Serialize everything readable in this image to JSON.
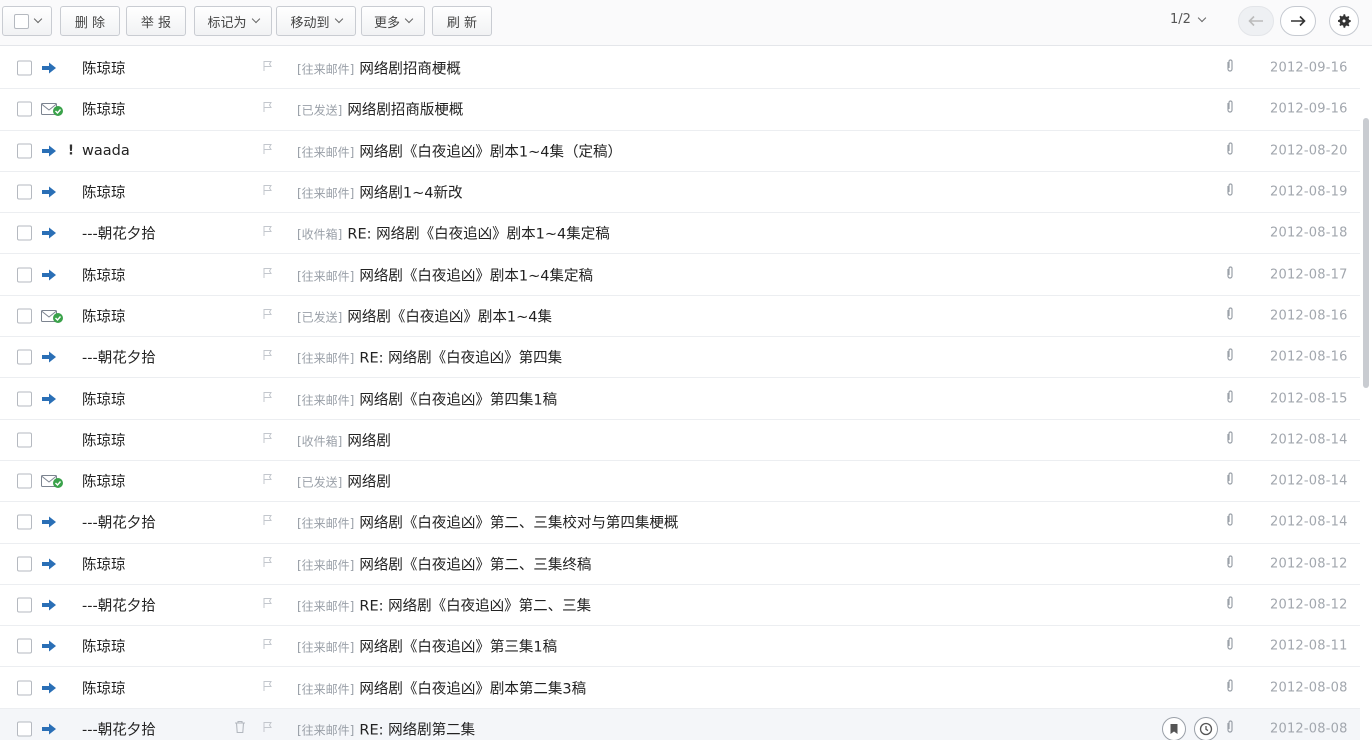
{
  "toolbar": {
    "delete_label": "删 除",
    "report_label": "举 报",
    "mark_as_label": "标记为",
    "move_to_label": "移动到",
    "more_label": "更多",
    "refresh_label": "刷 新",
    "page_indicator": "1/2"
  },
  "colors": {
    "arrow_blue": "#2a6fb6",
    "sent_green": "#3aa24a",
    "folder_gray": "#9aa0a8",
    "date_gray": "#a2a7ae"
  },
  "emails": [
    {
      "sender": "陈琼琼",
      "icon": "forward-arrow-icon",
      "important": "",
      "folder": "[往来邮件]",
      "subject": "网络剧招商梗概",
      "attachment": true,
      "date": "2012-09-16"
    },
    {
      "sender": "陈琼琼",
      "icon": "sent-envelope-icon",
      "important": "",
      "folder": "[已发送]",
      "subject": "网络剧招商版梗概",
      "attachment": true,
      "date": "2012-09-16"
    },
    {
      "sender": "waada",
      "icon": "forward-arrow-icon",
      "important": "!",
      "folder": "[往来邮件]",
      "subject": "网络剧《白夜追凶》剧本1~4集（定稿）",
      "attachment": true,
      "date": "2012-08-20"
    },
    {
      "sender": "陈琼琼",
      "icon": "forward-arrow-icon",
      "important": "",
      "folder": "[往来邮件]",
      "subject": "网络剧1~4新改",
      "attachment": true,
      "date": "2012-08-19"
    },
    {
      "sender": "---朝花夕拾",
      "icon": "forward-arrow-icon",
      "important": "",
      "folder": "[收件箱]",
      "subject": "RE: 网络剧《白夜追凶》剧本1~4集定稿",
      "attachment": false,
      "date": "2012-08-18"
    },
    {
      "sender": "陈琼琼",
      "icon": "forward-arrow-icon",
      "important": "",
      "folder": "[往来邮件]",
      "subject": "网络剧《白夜追凶》剧本1~4集定稿",
      "attachment": true,
      "date": "2012-08-17"
    },
    {
      "sender": "陈琼琼",
      "icon": "sent-envelope-icon",
      "important": "",
      "folder": "[已发送]",
      "subject": "网络剧《白夜追凶》剧本1~4集",
      "attachment": true,
      "date": "2012-08-16"
    },
    {
      "sender": "---朝花夕拾",
      "icon": "forward-arrow-icon",
      "important": "",
      "folder": "[往来邮件]",
      "subject": "RE: 网络剧《白夜追凶》第四集",
      "attachment": true,
      "date": "2012-08-16"
    },
    {
      "sender": "陈琼琼",
      "icon": "forward-arrow-icon",
      "important": "",
      "folder": "[往来邮件]",
      "subject": "网络剧《白夜追凶》第四集1稿",
      "attachment": true,
      "date": "2012-08-15"
    },
    {
      "sender": "陈琼琼",
      "icon": "none",
      "important": "",
      "folder": "[收件箱]",
      "subject": "网络剧",
      "attachment": true,
      "date": "2012-08-14"
    },
    {
      "sender": "陈琼琼",
      "icon": "sent-envelope-icon",
      "important": "",
      "folder": "[已发送]",
      "subject": "网络剧",
      "attachment": true,
      "date": "2012-08-14"
    },
    {
      "sender": "---朝花夕拾",
      "icon": "forward-arrow-icon",
      "important": "",
      "folder": "[往来邮件]",
      "subject": "网络剧《白夜追凶》第二、三集校对与第四集梗概",
      "attachment": true,
      "date": "2012-08-14"
    },
    {
      "sender": "陈琼琼",
      "icon": "forward-arrow-icon",
      "important": "",
      "folder": "[往来邮件]",
      "subject": "网络剧《白夜追凶》第二、三集终稿",
      "attachment": true,
      "date": "2012-08-12"
    },
    {
      "sender": "---朝花夕拾",
      "icon": "forward-arrow-icon",
      "important": "",
      "folder": "[往来邮件]",
      "subject": "RE: 网络剧《白夜追凶》第二、三集",
      "attachment": true,
      "date": "2012-08-12"
    },
    {
      "sender": "陈琼琼",
      "icon": "forward-arrow-icon",
      "important": "",
      "folder": "[往来邮件]",
      "subject": "网络剧《白夜追凶》第三集1稿",
      "attachment": true,
      "date": "2012-08-11"
    },
    {
      "sender": "陈琼琼",
      "icon": "forward-arrow-icon",
      "important": "",
      "folder": "[往来邮件]",
      "subject": "网络剧《白夜追凶》剧本第二集3稿",
      "attachment": true,
      "date": "2012-08-08"
    },
    {
      "sender": "---朝花夕拾",
      "icon": "forward-arrow-icon",
      "important": "",
      "folder": "[往来邮件]",
      "subject": "RE: 网络剧第二集",
      "attachment": true,
      "date": "2012-08-08",
      "hover": true
    }
  ]
}
